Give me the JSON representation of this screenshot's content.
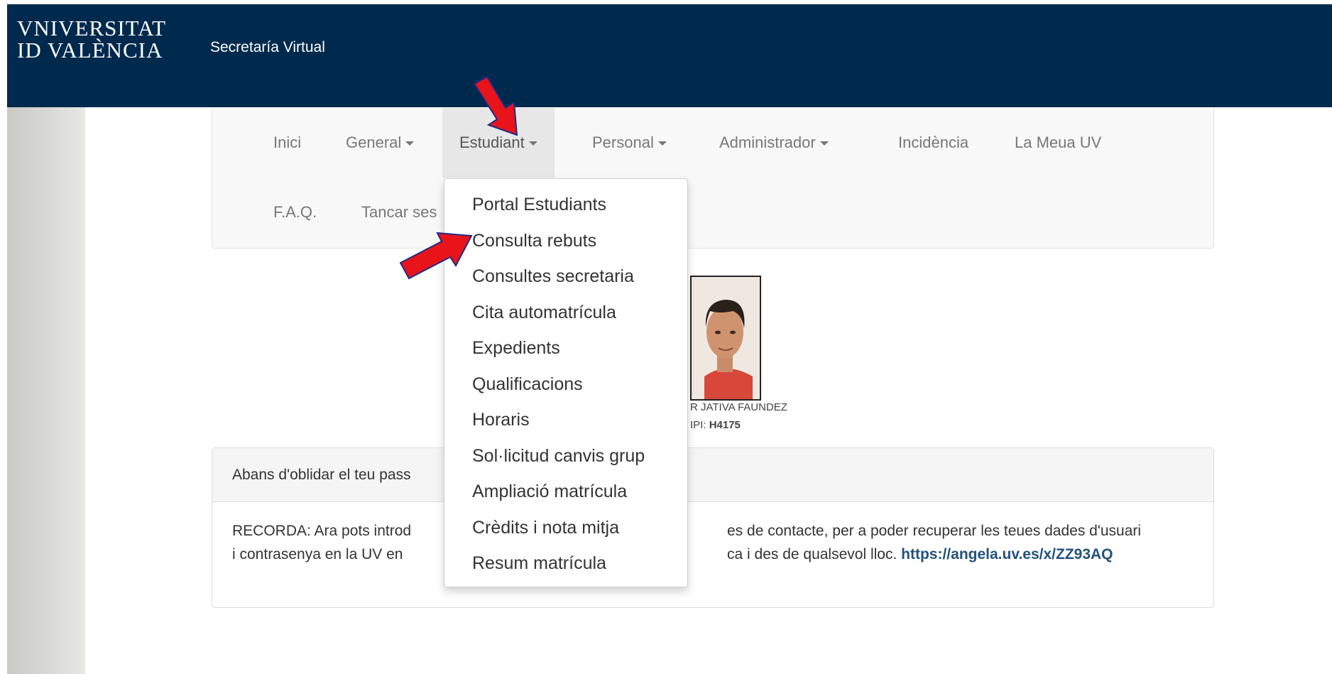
{
  "header": {
    "logo_line1": "VNIVERSITAT",
    "logo_line2": "ID VALÈNCIA",
    "app_title": "Secretaría Virtual"
  },
  "nav": {
    "items": [
      {
        "label": "Inici",
        "dropdown": false
      },
      {
        "label": "General",
        "dropdown": true
      },
      {
        "label": "Estudiant",
        "dropdown": true,
        "active": true
      },
      {
        "label": "Personal",
        "dropdown": true
      },
      {
        "label": "Administrador",
        "dropdown": true
      },
      {
        "label": "Incidència",
        "dropdown": false
      },
      {
        "label": "La Meua UV",
        "dropdown": false
      },
      {
        "label": "F.A.Q.",
        "dropdown": false
      },
      {
        "label": "Tancar ses",
        "dropdown": false
      }
    ]
  },
  "dropdown_menu": {
    "items": [
      "Portal Estudiants",
      "Consulta rebuts",
      "Consultes secretaria",
      "Cita automatrícula",
      "Expedients",
      "Qualificacions",
      "Horaris",
      "Sol·licitud canvis grup",
      "Ampliació matrícula",
      "Crèdits i nota mitja",
      "Resum matrícula"
    ]
  },
  "profile": {
    "name": "R JATIVA FAUNDEZ",
    "nip_prefix": "IPI:",
    "nip_value": "H4175"
  },
  "notice": {
    "heading": "Abans d'oblidar el teu pass",
    "body_line1_a": "RECORDA: Ara pots introd",
    "body_line1_b": "es de contacte, per a poder recuperar les teues dades d'usuari",
    "body_line2_a": "i contrasenya en la UV en",
    "body_line2_b": "ca i des de qualsevol lloc.",
    "link": "https://angela.uv.es/x/ZZ93AQ"
  },
  "colors": {
    "header_bg": "#002a4d",
    "navbar_bg": "#f8f8f8",
    "active_tab_bg": "#e7e7e7",
    "link": "#23527c",
    "annotation_arrow": "#e8141a"
  }
}
